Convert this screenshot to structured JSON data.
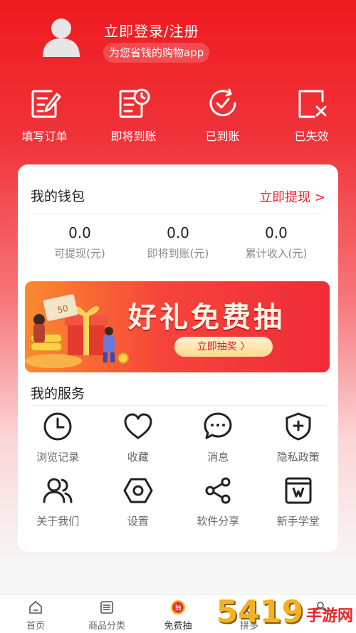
{
  "header": {
    "login_text": "立即登录/注册",
    "tagline": "为您省钱的购物app"
  },
  "orders": [
    {
      "label": "填写订单",
      "icon": "edit-order-icon"
    },
    {
      "label": "即将到账",
      "icon": "pending-icon"
    },
    {
      "label": "已到账",
      "icon": "arrived-icon"
    },
    {
      "label": "已失效",
      "icon": "expired-icon"
    }
  ],
  "wallet": {
    "title": "我的钱包",
    "withdraw_label": "立即提现 >",
    "stats": [
      {
        "value": "0.0",
        "label": "可提现(元)"
      },
      {
        "value": "0.0",
        "label": "即将到账(元)"
      },
      {
        "value": "0.0",
        "label": "累计收入(元)"
      }
    ]
  },
  "banner": {
    "title": "好礼免费抽",
    "button": "立即抽奖 〉",
    "coupon_text": "50"
  },
  "services": {
    "title": "我的服务",
    "items": [
      {
        "label": "浏览记录",
        "icon": "clock-icon"
      },
      {
        "label": "收藏",
        "icon": "heart-icon"
      },
      {
        "label": "消息",
        "icon": "message-icon"
      },
      {
        "label": "隐私政策",
        "icon": "shield-plus-icon"
      },
      {
        "label": "关于我们",
        "icon": "users-icon"
      },
      {
        "label": "设置",
        "icon": "settings-icon"
      },
      {
        "label": "软件分享",
        "icon": "share-icon"
      },
      {
        "label": "新手学堂",
        "icon": "book-icon"
      }
    ]
  },
  "tabbar": {
    "tabs": [
      {
        "label": "首页",
        "icon": "home-icon"
      },
      {
        "label": "商品分类",
        "icon": "category-icon"
      },
      {
        "label": "免费抽",
        "icon": "lottery-icon",
        "badge": "抽"
      },
      {
        "label": "拼多",
        "icon": "tag-icon"
      },
      {
        "label": "",
        "icon": "profile-icon"
      }
    ]
  },
  "watermark": {
    "number": "5419",
    "text": "手游网"
  },
  "colors": {
    "brand_red": "#ee1b20",
    "accent_red": "#e8262b",
    "gold": "#f3b223"
  }
}
